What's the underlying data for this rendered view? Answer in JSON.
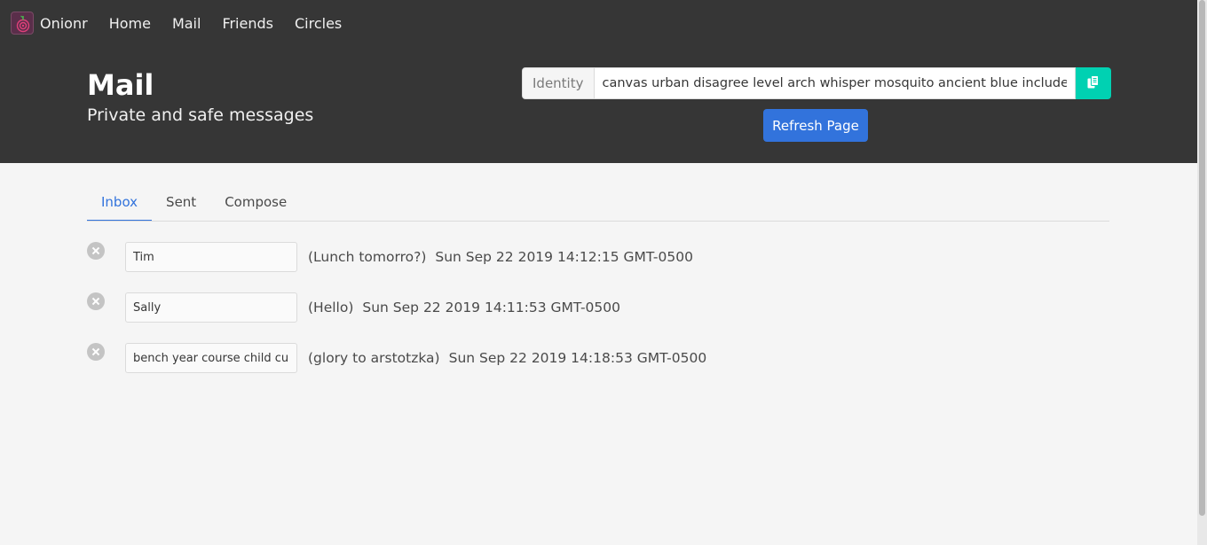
{
  "navbar": {
    "brand": "Onionr",
    "items": [
      {
        "label": "Home"
      },
      {
        "label": "Mail"
      },
      {
        "label": "Friends"
      },
      {
        "label": "Circles"
      }
    ]
  },
  "hero": {
    "title": "Mail",
    "subtitle": "Private and safe messages",
    "identity_label": "Identity",
    "identity_value": "canvas urban disagree level arch whisper mosquito ancient blue include ele",
    "refresh_label": "Refresh Page"
  },
  "tabs": [
    {
      "label": "Inbox",
      "active": true
    },
    {
      "label": "Sent",
      "active": false
    },
    {
      "label": "Compose",
      "active": false
    }
  ],
  "messages": [
    {
      "sender": "Tim",
      "subject": "(Lunch tomorro?)",
      "date": "Sun Sep 22 2019 14:12:15 GMT-0500"
    },
    {
      "sender": "Sally",
      "subject": "(Hello)",
      "date": "Sun Sep 22 2019 14:11:53 GMT-0500"
    },
    {
      "sender": "bench year course child currer",
      "subject": "(glory to arstotzka)",
      "date": "Sun Sep 22 2019 14:18:53 GMT-0500"
    }
  ],
  "icons": {
    "logo": "onion-logo-icon",
    "copy": "copy-icon",
    "delete": "delete-icon"
  },
  "colors": {
    "header_bg": "#363636",
    "accent_blue": "#3273dc",
    "accent_teal": "#00d1b2"
  }
}
